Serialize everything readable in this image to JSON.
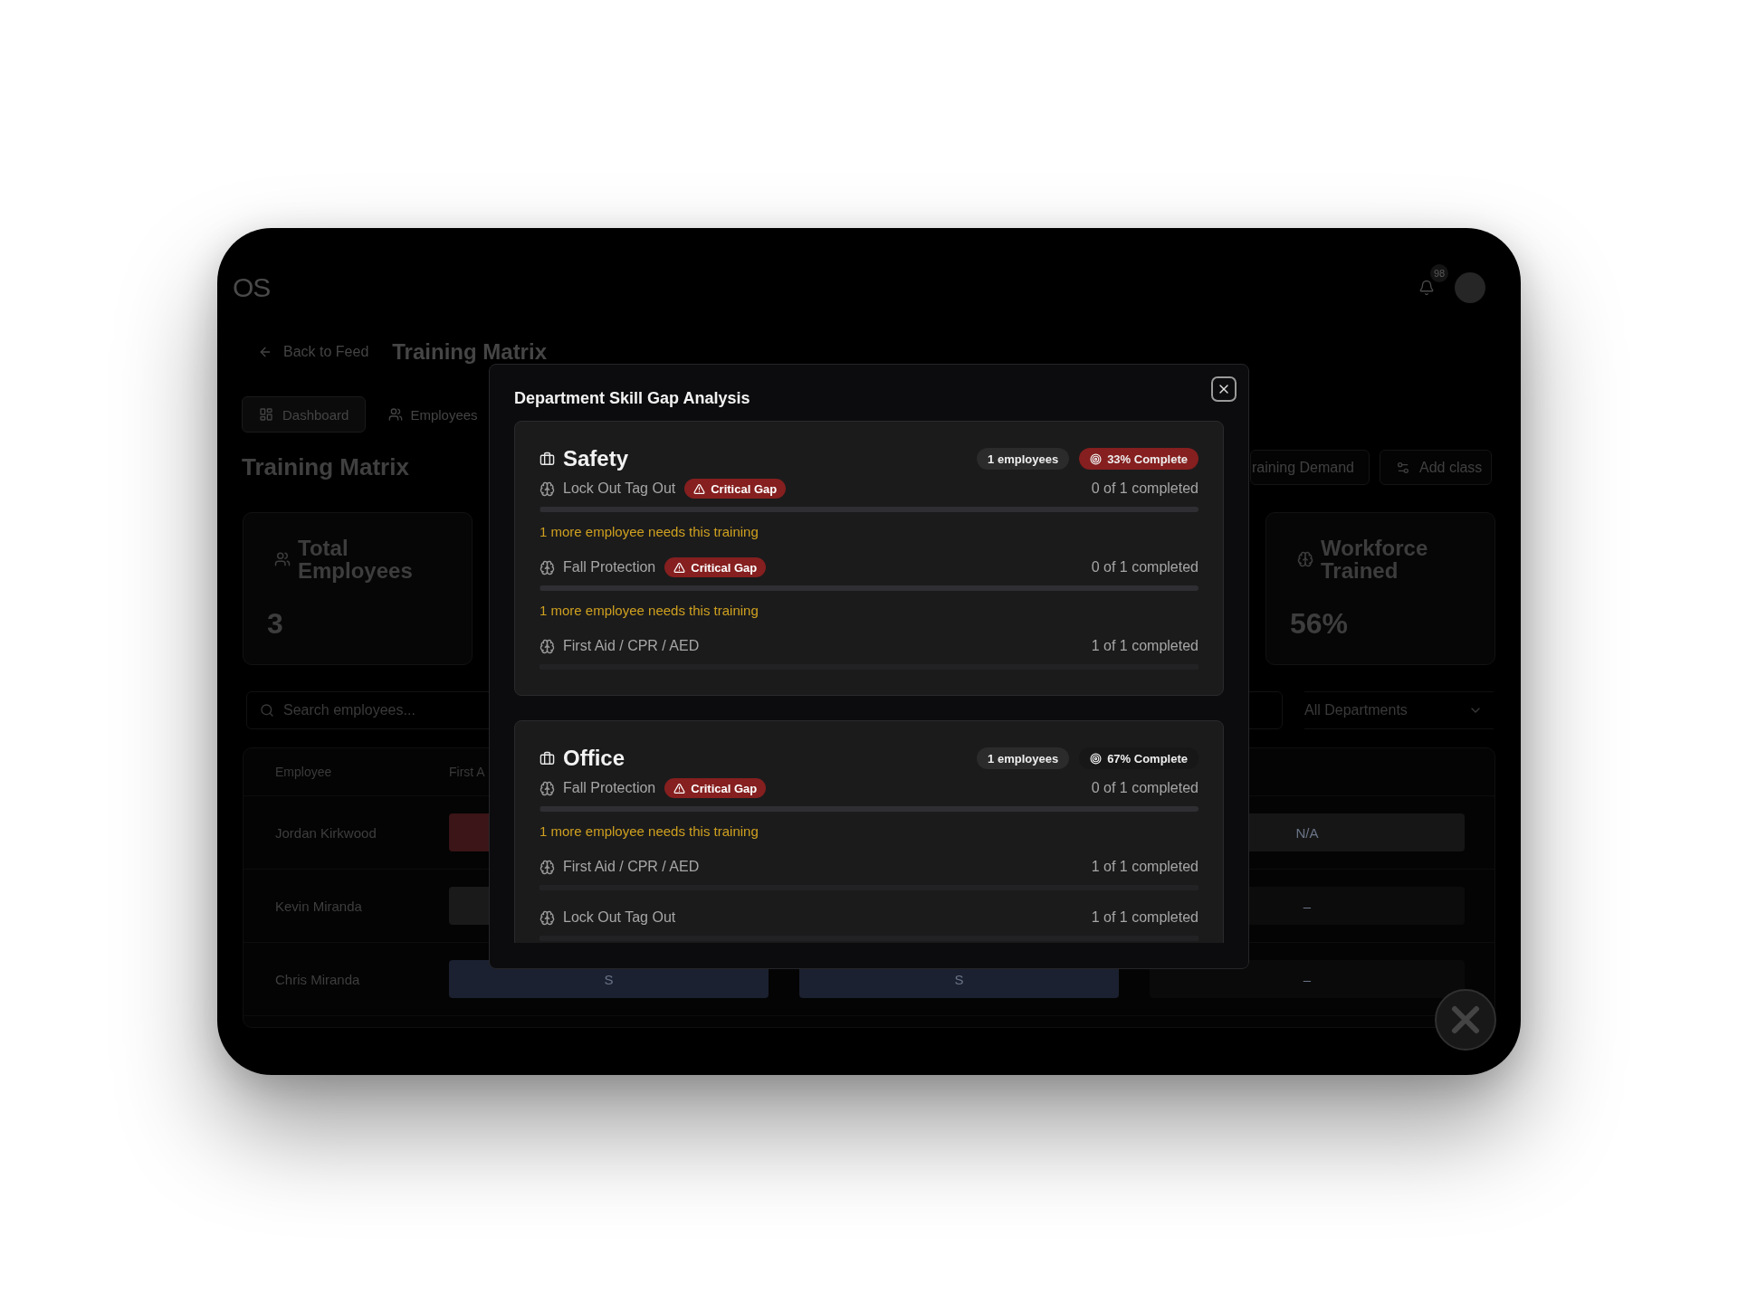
{
  "header": {
    "logo": "OS",
    "notification_count": "98"
  },
  "nav": {
    "back_link": "Back to Feed",
    "title": "Training Matrix"
  },
  "tabs": [
    {
      "label": "Dashboard",
      "selected": true
    },
    {
      "label": "Employees",
      "selected": false
    }
  ],
  "page": {
    "heading": "Training Matrix",
    "actions": [
      {
        "label": "raining Demand"
      },
      {
        "label": "Add class"
      }
    ]
  },
  "stats": [
    {
      "label": "Total Employees",
      "value": "3"
    },
    {
      "label": "Workforce Trained",
      "value": "56%"
    }
  ],
  "filters": {
    "search": {
      "placeholder": "Search employees..."
    },
    "department": {
      "value": "All Departments"
    }
  },
  "table": {
    "columns": [
      "Employee",
      "First A"
    ],
    "rows": [
      {
        "employee": "Jordan Kirkwood",
        "column_2": {
          "color": "#3b1517"
        },
        "column_4": {
          "text": "N/A",
          "color": "#161616"
        }
      },
      {
        "employee": "Kevin Miranda",
        "column_2": {
          "color": "#1a1a1a"
        },
        "column_4": {
          "text": "–",
          "color": "#0c0c0c"
        }
      },
      {
        "employee": "Chris Miranda",
        "column_2": {
          "text": "S",
          "color": "#1b2130"
        },
        "column_3": {
          "text": "S",
          "color": "#1b2130"
        },
        "column_4": {
          "text": "–",
          "color": "#0a0a0a"
        }
      }
    ]
  },
  "modal": {
    "title": "Department Skill Gap Analysis",
    "departments": [
      {
        "name": "Safety",
        "employees": "1 employees",
        "completion": "33% Complete",
        "critical": true,
        "skills": [
          {
            "name": "Lock Out Tag Out",
            "badge": "Critical Gap",
            "progress": "0 of 1 completed",
            "level": 0,
            "note": "1 more employee needs this training"
          },
          {
            "name": "Fall Protection",
            "badge": "Critical Gap",
            "progress": "0 of 1 completed",
            "level": 0,
            "note": "1 more employee needs this training"
          },
          {
            "name": "First Aid / CPR / AED",
            "progress": "1 of 1 completed",
            "level": 1
          }
        ]
      },
      {
        "name": "Office",
        "employees": "1 employees",
        "completion": "67% Complete",
        "critical": false,
        "skills": [
          {
            "name": "Fall Protection",
            "badge": "Critical Gap",
            "progress": "0 of 1 completed",
            "level": 0,
            "note": "1 more employee needs this training"
          },
          {
            "name": "First Aid / CPR / AED",
            "progress": "1 of 1 completed",
            "level": 1
          },
          {
            "name": "Lock Out Tag Out",
            "progress": "1 of 1 completed",
            "level": 1
          }
        ]
      }
    ]
  }
}
